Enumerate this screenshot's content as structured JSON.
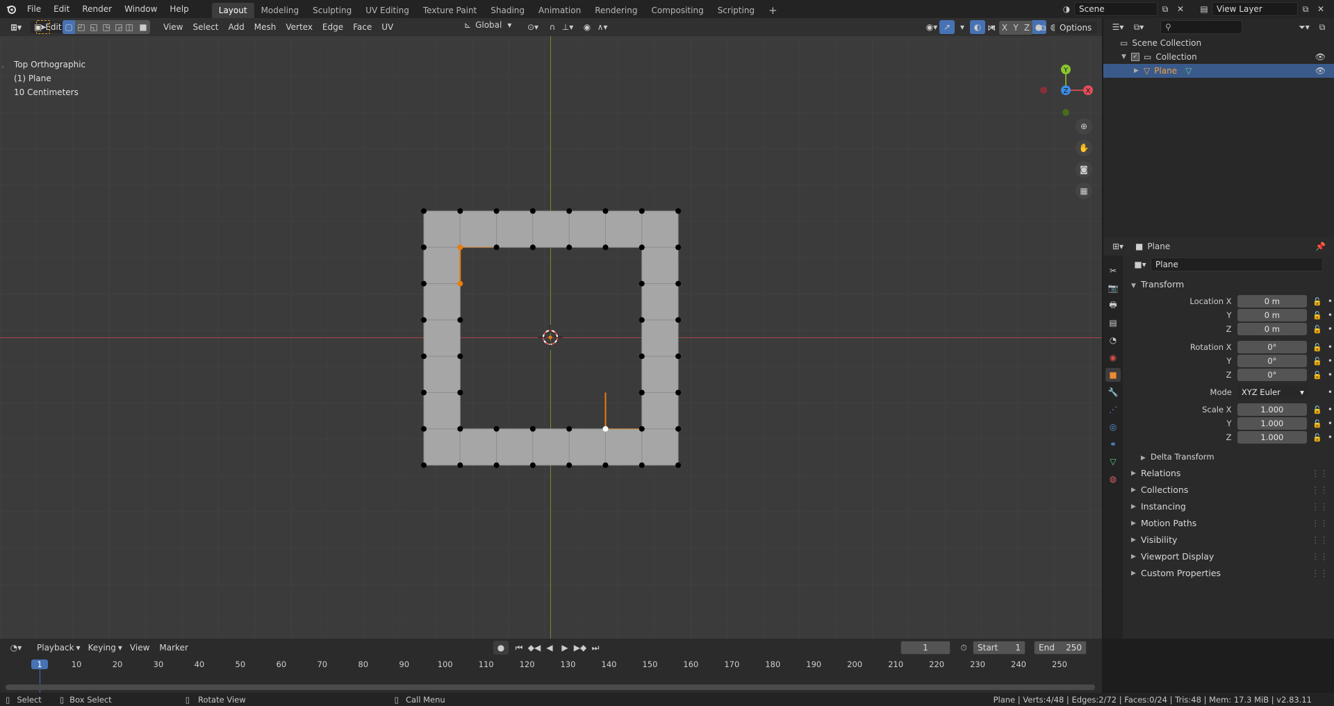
{
  "menu": [
    "File",
    "Edit",
    "Render",
    "Window",
    "Help"
  ],
  "workspaces": [
    "Layout",
    "Modeling",
    "Sculpting",
    "UV Editing",
    "Texture Paint",
    "Shading",
    "Animation",
    "Rendering",
    "Compositing",
    "Scripting"
  ],
  "active_workspace": "Layout",
  "add_tab": "+",
  "scene_name": "Scene",
  "view_layer_name": "View Layer",
  "header": {
    "mode": "Edit Mode",
    "menus": [
      "View",
      "Select",
      "Add",
      "Mesh",
      "Vertex",
      "Edge",
      "Face",
      "UV"
    ],
    "transform_orientation": "Global",
    "options_label": "Options",
    "axes": [
      "X",
      "Y",
      "Z"
    ]
  },
  "overlay": {
    "view_name": "Top Orthographic",
    "object_name": "(1) Plane",
    "grid_scale": "10 Centimeters"
  },
  "gizmo": {
    "y": "Y",
    "z": "Z",
    "x": "X"
  },
  "outliner": {
    "scene_collection": "Scene Collection",
    "collection": "Collection",
    "plane": "Plane",
    "search_placeholder": ""
  },
  "properties": {
    "context_name": "Plane",
    "object_name": "Plane",
    "transform_title": "Transform",
    "location": {
      "label_x": "Location X",
      "label_y": "Y",
      "label_z": "Z",
      "x": "0 m",
      "y": "0 m",
      "z": "0 m"
    },
    "rotation": {
      "label_x": "Rotation X",
      "label_y": "Y",
      "label_z": "Z",
      "x": "0°",
      "y": "0°",
      "z": "0°"
    },
    "mode_label": "Mode",
    "mode_value": "XYZ Euler",
    "scale": {
      "label_x": "Scale X",
      "label_y": "Y",
      "label_z": "Z",
      "x": "1.000",
      "y": "1.000",
      "z": "1.000"
    },
    "delta_transform": "Delta Transform",
    "panels": [
      "Relations",
      "Collections",
      "Instancing",
      "Motion Paths",
      "Visibility",
      "Viewport Display",
      "Custom Properties"
    ]
  },
  "timeline": {
    "menus": [
      "Playback",
      "Keying",
      "View",
      "Marker"
    ],
    "current_frame": "1",
    "start_label": "Start",
    "start_value": "1",
    "end_label": "End",
    "end_value": "250",
    "ticks": [
      "1",
      "10",
      "20",
      "30",
      "40",
      "50",
      "60",
      "70",
      "80",
      "90",
      "100",
      "110",
      "120",
      "130",
      "140",
      "150",
      "160",
      "170",
      "180",
      "190",
      "200",
      "210",
      "220",
      "230",
      "240",
      "250"
    ]
  },
  "status": {
    "select": "Select",
    "box_select": "Box Select",
    "rotate_view": "Rotate View",
    "call_menu": "Call Menu",
    "stats": "Plane | Verts:4/48 | Edges:2/72 | Faces:0/24 | Tris:48 | Mem: 17.3 MiB | v2.83.11"
  },
  "colors": {
    "selected_orange": "#e87d0d",
    "axis_red": "#c84c4c",
    "axis_green": "#7ca82a",
    "mesh_face": "#a6a6a6",
    "highlight_blue": "#3a5a8c"
  }
}
